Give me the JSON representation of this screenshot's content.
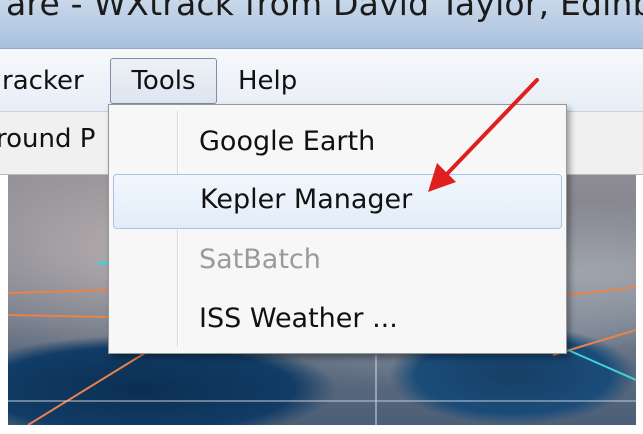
{
  "window": {
    "title": "are - WXtrack from David Taylor, Edinburgh"
  },
  "menubar": {
    "items": [
      {
        "label": "racker"
      },
      {
        "label": "Tools"
      },
      {
        "label": "Help"
      }
    ]
  },
  "toolbar": {
    "tab_label": "round P"
  },
  "tools_menu": {
    "items": [
      {
        "label": "Google Earth",
        "enabled": true
      },
      {
        "label": "Kepler Manager",
        "enabled": true,
        "highlighted": true
      },
      {
        "label": "SatBatch",
        "enabled": false
      },
      {
        "label": "ISS Weather ...",
        "enabled": true
      }
    ]
  },
  "annotation": {
    "arrow_color": "#e02020",
    "points_to": "Kepler Manager"
  },
  "colors": {
    "menu_highlight": "#dde9f7",
    "disabled_text": "#9a9a9a"
  }
}
